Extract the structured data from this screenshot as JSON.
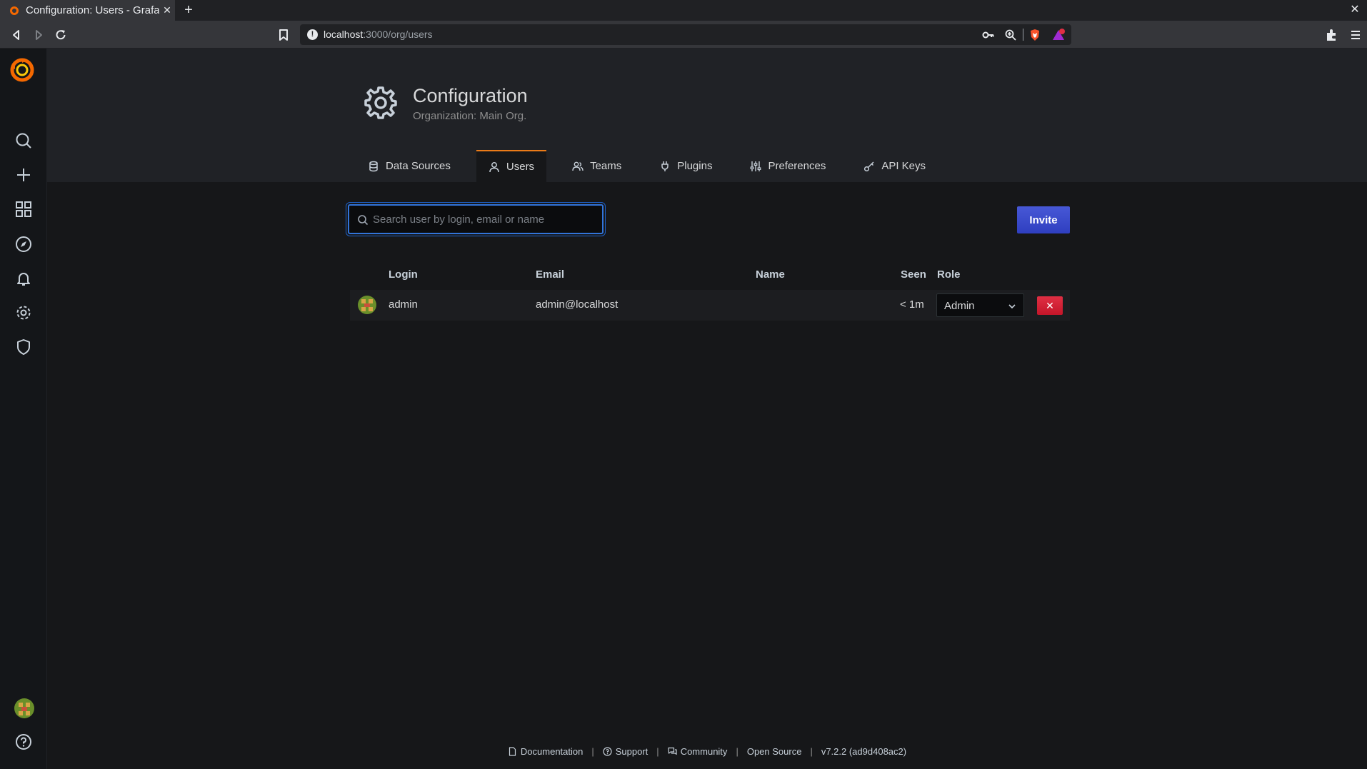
{
  "browser": {
    "tab_title": "Configuration: Users - Grafa",
    "url_host": "localhost",
    "url_path": ":3000/org/users"
  },
  "header": {
    "title": "Configuration",
    "subtitle": "Organization: Main Org."
  },
  "tabs": [
    {
      "label": "Data Sources",
      "icon": "database-icon"
    },
    {
      "label": "Users",
      "icon": "user-icon",
      "active": true
    },
    {
      "label": "Teams",
      "icon": "users-icon"
    },
    {
      "label": "Plugins",
      "icon": "plug-icon"
    },
    {
      "label": "Preferences",
      "icon": "sliders-icon"
    },
    {
      "label": "API Keys",
      "icon": "key-icon"
    }
  ],
  "search": {
    "placeholder": "Search user by login, email or name",
    "value": ""
  },
  "invite_label": "Invite",
  "table": {
    "columns": [
      "Login",
      "Email",
      "Name",
      "Seen",
      "Role"
    ],
    "rows": [
      {
        "login": "admin",
        "email": "admin@localhost",
        "name": "",
        "seen": "< 1m",
        "role": "Admin"
      }
    ]
  },
  "footer": {
    "links": [
      "Documentation",
      "Support",
      "Community",
      "Open Source"
    ],
    "version": "v7.2.2 (ad9d408ac2)"
  },
  "colors": {
    "accent": "#eb7b18",
    "primary_button": "#3d4ecf",
    "danger_button": "#e02f44",
    "background": "#161719"
  }
}
